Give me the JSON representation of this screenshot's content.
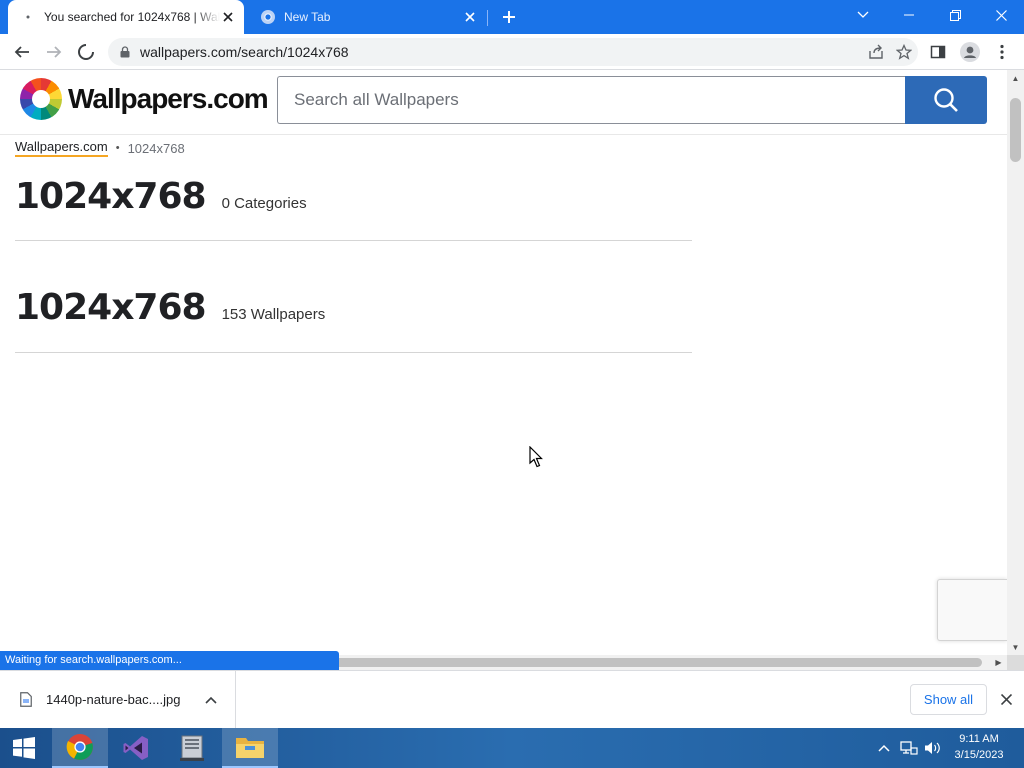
{
  "browser": {
    "tabs": [
      {
        "title": "You searched for 1024x768 | Wallpapers.com",
        "active": true
      },
      {
        "title": "New Tab",
        "active": false
      }
    ],
    "address_bar": {
      "url": "wallpapers.com/search/1024x768"
    },
    "status_text": "Waiting for search.wallpapers.com..."
  },
  "site": {
    "logo_text": "Wallpapers.com",
    "search": {
      "placeholder": "Search all Wallpapers",
      "value": ""
    },
    "breadcrumb": {
      "home": "Wallpapers.com",
      "separator": "•",
      "current": "1024x768"
    },
    "sections": [
      {
        "heading": "1024x768",
        "count": "0 Categories"
      },
      {
        "heading": "1024x768",
        "count": "153 Wallpapers"
      }
    ]
  },
  "downloads": {
    "file_name": "1440p-nature-bac....jpg",
    "show_all_label": "Show all"
  },
  "taskbar": {
    "time": "9:11 AM",
    "date": "3/15/2023"
  },
  "colors": {
    "tab_strip": "#1a73e8",
    "search_button": "#2d6ab7",
    "breadcrumb_underline": "#f5a623",
    "taskbar": "#1f5c9c"
  }
}
